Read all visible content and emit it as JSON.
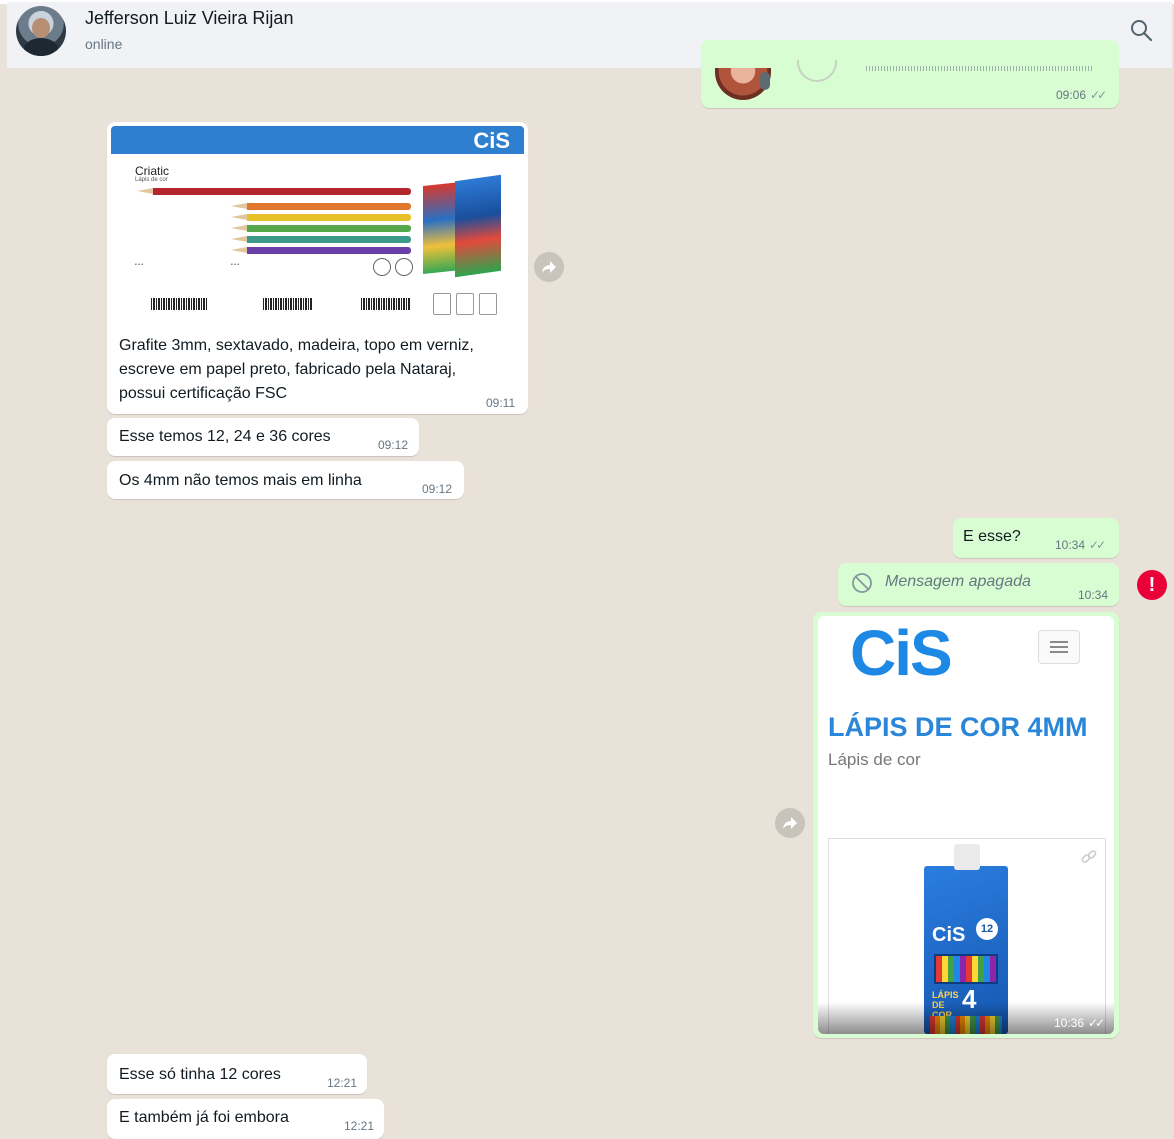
{
  "header": {
    "contact_name": "Jefferson Luiz Vieira Rijan",
    "status": "online",
    "search_icon": "search-icon"
  },
  "messages": {
    "voice_time": "09:06",
    "image_caption_line1": "Grafite 3mm, sextavado, madeira, topo em verniz,",
    "image_caption_line2": "escreve em papel preto, fabricado pela Nataraj,",
    "image_caption_line3": "possui certificação FSC",
    "image_time": "09:11",
    "msg2_text": "Esse temos 12, 24 e 36 cores",
    "msg2_time": "09:12",
    "msg3_text": "Os 4mm não temos mais em linha",
    "msg3_time": "09:12",
    "msg4_text": "E esse?",
    "msg4_time": "10:34",
    "deleted_text": "Mensagem apagada",
    "deleted_time": "10:34",
    "link_time": "10:36",
    "msg6_text": "Esse só tinha 12 cores",
    "msg6_time": "12:21",
    "msg7_text": "E também já foi embora",
    "msg7_time": "12:21"
  },
  "sheet": {
    "brand": "CiS",
    "title": "Criatic",
    "subtitle": "Lápis de cor"
  },
  "link_preview": {
    "logo": "CiS",
    "title": "LÁPIS DE COR 4MM",
    "subtitle": "Lápis de cor",
    "box_brand": "CiS",
    "box_count": "12",
    "box_label_big": "4",
    "box_label_small": "LÁPIS DE COR"
  },
  "colors": {
    "incoming": "#ffffff",
    "outgoing": "#d9fdd3",
    "background": "#e9e2d8",
    "accent_blue": "#2a86d8",
    "error_red": "#ea0038"
  }
}
